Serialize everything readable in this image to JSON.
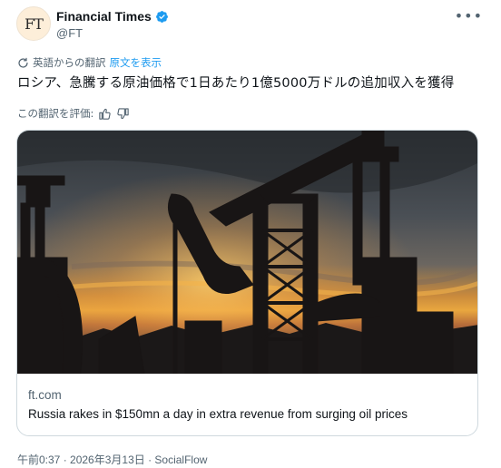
{
  "author": {
    "avatar_text": "FT",
    "display_name": "Financial Times",
    "handle": "@FT",
    "verified": true,
    "verified_color": "#1d9bf0"
  },
  "menu_icon": "more-dots-icon",
  "translation": {
    "label": "英語からの翻訳",
    "show_original": "原文を表示"
  },
  "tweet": {
    "text": "ロシア、急騰する原油価格で1日あたり1億5000万ドルの追加収入を獲得"
  },
  "rating": {
    "label": "この翻訳を評価:"
  },
  "card": {
    "domain": "ft.com",
    "title": "Russia rakes in $150mn a day in extra revenue from surging oil prices"
  },
  "meta": {
    "text": "午前0:37 · 2026年3月13日 · SocialFlow"
  }
}
